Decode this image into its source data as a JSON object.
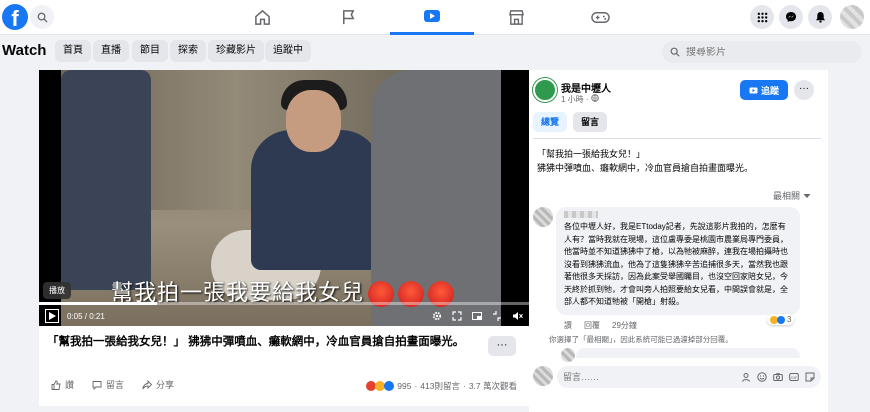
{
  "topbar": {
    "nav": [
      "home-icon",
      "flag-icon",
      "watch-icon",
      "marketplace-icon",
      "gaming-icon"
    ],
    "active_nav": "watch-icon"
  },
  "subnav": {
    "title": "Watch",
    "pills": [
      "首頁",
      "直播",
      "節目",
      "探索",
      "珍藏影片",
      "追蹤中"
    ],
    "search_placeholder": "搜尋影片"
  },
  "video": {
    "caption": "幫我拍一張我要給我女兒",
    "tooltip": "播放",
    "time": "0:05 / 0:21",
    "progress": 0.24,
    "title": "「幫我拍一張給我女兒！」 狒狒中彈噴血、癱軟網中，冷血官員搶自拍畫面曝光。",
    "more": "···"
  },
  "actions": {
    "like": "讚",
    "comment": "留言",
    "share": "分享"
  },
  "stats": {
    "reactions": "995",
    "comments": "413則留言",
    "views": "3.7 萬次觀看",
    "separator": "·"
  },
  "page": {
    "name": "我是中壢人",
    "meta": "1 小時 ·",
    "follow": "追蹤",
    "more": "···",
    "tabs": [
      "總覽",
      "留言"
    ],
    "description_line1": "「幫我拍一張給我女兒！」",
    "description_line2": "狒狒中彈噴血、癱軟網中，冷血官員搶自拍畫面曝光。"
  },
  "comments": {
    "sort": "最相關",
    "first": {
      "text": "各位中壢人好，我是ETtoday記者，先說這影片我拍的，怎麼有人有？當時我就在現場，這位盧專委是桃園市農業局專門委員，他當時並不知道狒狒中了槍，以為牠被麻醉，連我在場拍攝時也沒看到狒狒流血，他為了這隻狒狒辛苦追捕很多天，當然我也跟著他很多天採訪，因為此案受舉國矚目，也沒空回家陪女兒，今天終於抓到牠，才會叫旁人拍照要給女兒看，中間誤會就是，全部人都不知道牠被「開槍」射殺。",
      "like": "讚",
      "reply": "回覆",
      "time": "29分鐘",
      "reaction_count": "3"
    },
    "notice": "你選擇了「最相關」，因此系統可能已過濾掉部分回覆。",
    "input_placeholder": "留言……"
  },
  "colors": {
    "accent": "#1877f2",
    "page_green": "#2f9a4d"
  }
}
